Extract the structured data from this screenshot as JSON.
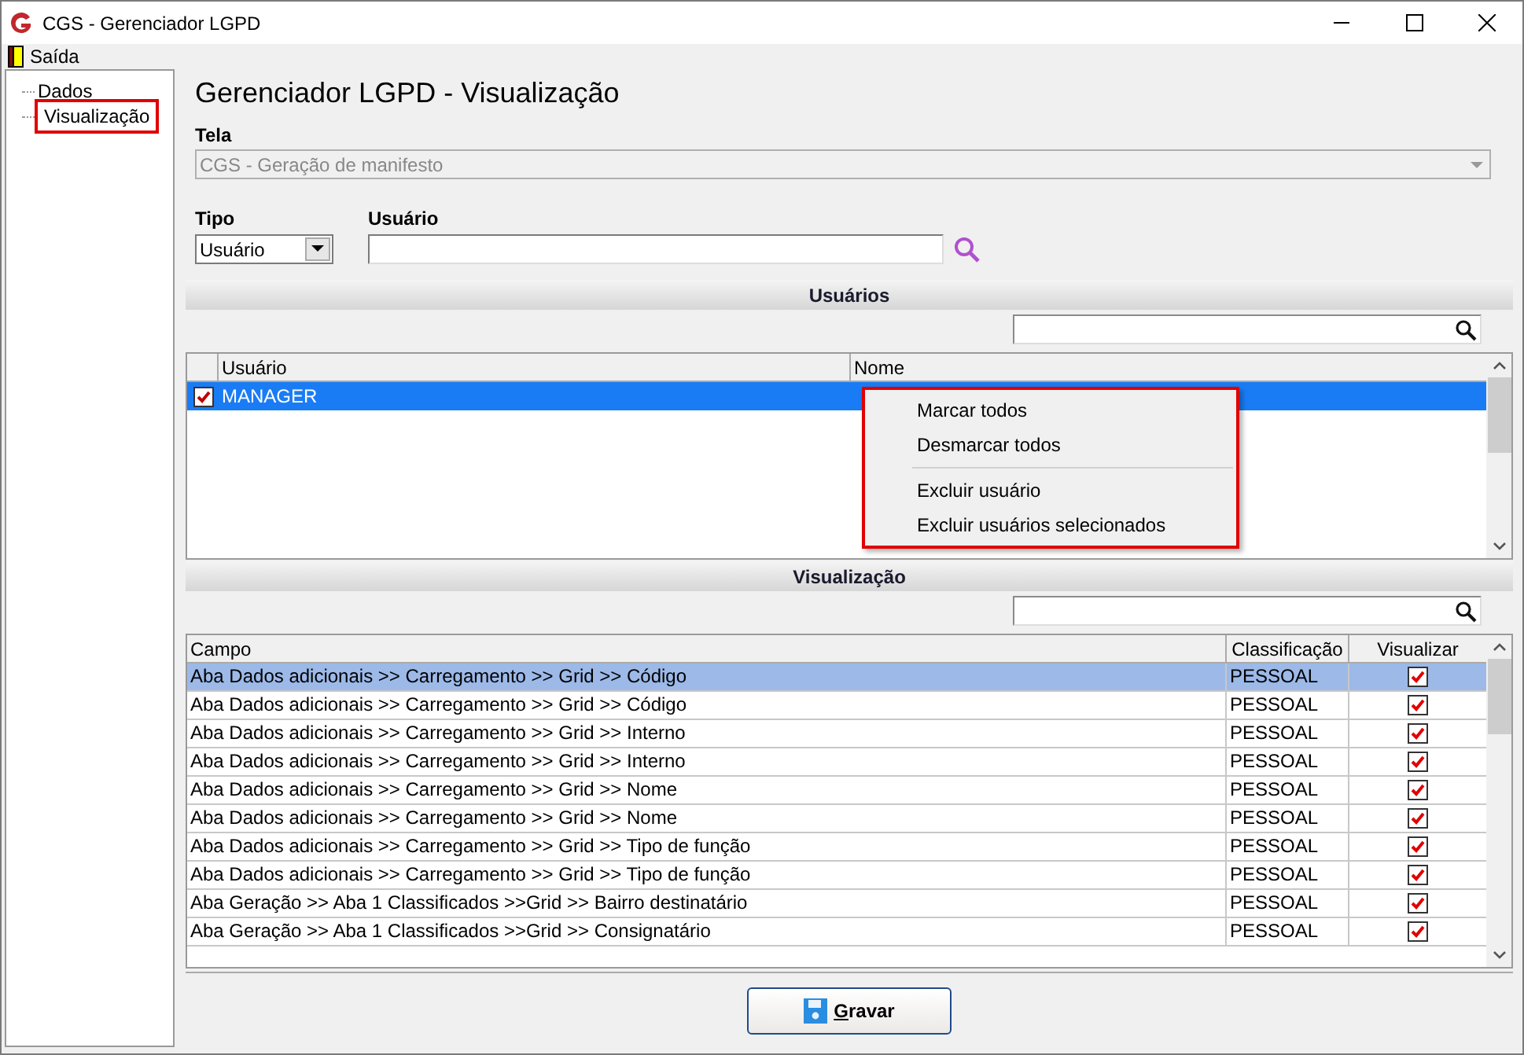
{
  "window": {
    "title": "CGS - Gerenciador LGPD"
  },
  "menu": [
    {
      "label": "Saída"
    }
  ],
  "tree": [
    {
      "label": "Dados",
      "highlighted": false
    },
    {
      "label": "Visualização",
      "highlighted": true
    }
  ],
  "heading": "Gerenciador LGPD - Visualização",
  "tela": {
    "label": "Tela",
    "value": "CGS - Geração de manifesto",
    "disabled": true
  },
  "tipo": {
    "label": "Tipo",
    "value": "Usuário"
  },
  "usuario": {
    "label": "Usuário"
  },
  "users_section": {
    "title": "Usuários",
    "columns": [
      "Usuário",
      "Nome"
    ],
    "rows": [
      {
        "checked": true,
        "selected": true,
        "cells": [
          "MANAGER"
        ]
      }
    ]
  },
  "context_menu": {
    "items": [
      {
        "label": "Marcar todos",
        "kind": "item"
      },
      {
        "label": "Desmarcar todos",
        "kind": "item"
      },
      {
        "kind": "separator"
      },
      {
        "label": "Excluir usuário",
        "kind": "item"
      },
      {
        "label": "Excluir usuários selecionados",
        "kind": "item"
      }
    ]
  },
  "vis_section": {
    "title": "Visualização",
    "columns": [
      "Campo",
      "Classificação",
      "Visualizar"
    ],
    "rows": [
      {
        "campo": "Aba Dados adicionais >> Carregamento >> Grid >> Código",
        "classificacao": "PESSOAL",
        "checked": true,
        "selected": true
      },
      {
        "campo": "Aba Dados adicionais >> Carregamento >> Grid >> Código",
        "classificacao": "PESSOAL",
        "checked": true,
        "selected": false
      },
      {
        "campo": "Aba Dados adicionais >> Carregamento >> Grid >> Interno",
        "classificacao": "PESSOAL",
        "checked": true,
        "selected": false
      },
      {
        "campo": "Aba Dados adicionais >> Carregamento >> Grid >> Interno",
        "classificacao": "PESSOAL",
        "checked": true,
        "selected": false
      },
      {
        "campo": "Aba Dados adicionais >> Carregamento >> Grid >> Nome",
        "classificacao": "PESSOAL",
        "checked": true,
        "selected": false
      },
      {
        "campo": "Aba Dados adicionais >> Carregamento >> Grid >> Nome",
        "classificacao": "PESSOAL",
        "checked": true,
        "selected": false
      },
      {
        "campo": "Aba Dados adicionais >> Carregamento >> Grid >> Tipo de função",
        "classificacao": "PESSOAL",
        "checked": true,
        "selected": false
      },
      {
        "campo": "Aba Dados adicionais >> Carregamento >> Grid >> Tipo de função",
        "classificacao": "PESSOAL",
        "checked": true,
        "selected": false
      },
      {
        "campo": "Aba Geração >> Aba 1 Classificados >>Grid >> Bairro destinatário",
        "classificacao": "PESSOAL",
        "checked": true,
        "selected": false
      },
      {
        "campo": "Aba Geração >> Aba 1 Classificados >>Grid >> Consignatário",
        "classificacao": "PESSOAL",
        "checked": true,
        "selected": false
      }
    ]
  },
  "save_button": {
    "label": "Gravar"
  }
}
